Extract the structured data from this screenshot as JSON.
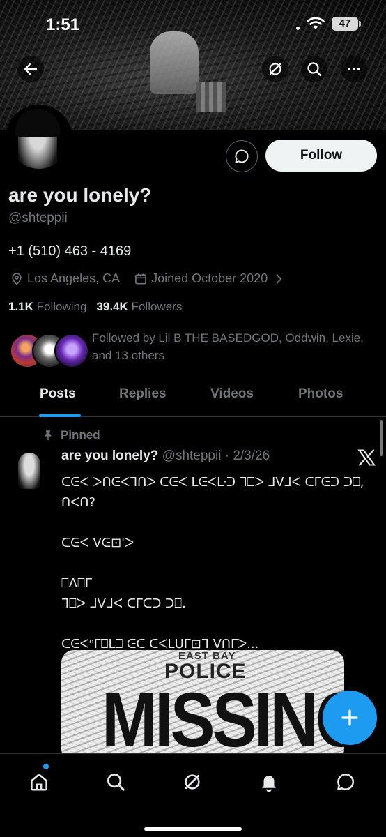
{
  "status_bar": {
    "time": "1:51",
    "battery": "47"
  },
  "profile": {
    "name": "are you lonely?",
    "handle": "@shteppii",
    "bio": "+1 (510) 463 - 4169",
    "location": "Los Angeles, CA",
    "joined": "Joined October 2020",
    "following_count": "1.1K",
    "following_label": "Following",
    "followers_count": "39.4K",
    "followers_label": "Followers",
    "followed_by": "Followed by Lil B THE BASEDGOD, Oddwin, Lexie, and 13 others"
  },
  "actions": {
    "follow_label": "Follow"
  },
  "tabs": [
    {
      "label": "Posts"
    },
    {
      "label": "Replies"
    },
    {
      "label": "Videos"
    },
    {
      "label": "Photos"
    }
  ],
  "pinned_post": {
    "pinned_label": "Pinned",
    "author_name": "are you lonely?",
    "author_meta": "@shteppii · 2/3/26",
    "text": "ᑕᕮᐸ ᐳᑎᕮᐸᒣᑎᐳ ᑕᕮᐸ ᒪᕮᐸᒷᑐ ᒣ⎕ᐳ ᒧᐯᒧᐸ ᑕᒥᕮᑐ ᑐ⎕,\nᑎᐸᑎ?\n\nᑕᕮᐸ ᐯᕮ⊡'ᐳ\n\n⎕ᐱ⎕ᒥ\nᒣ⎕ᐳ ᒧᐯᒧᐸ ᑕᒥᕮᑐ ᑐ⎕.\n\nᑕᕮᐸᐢᒥ⎕ᒪ⎕ ᕮᑕ ᑕᐸᒪᑌᒥ⊡ᒣ ᐯᑎᒥᐳ...",
    "image_text": {
      "top": "EAST BAY",
      "middle": "POLICE",
      "big": "MISSING"
    }
  },
  "icons": {
    "back": "back-arrow-icon",
    "grok": "grok-icon",
    "search": "search-icon",
    "more": "more-icon",
    "message": "message-icon",
    "location": "location-pin-icon",
    "calendar": "calendar-icon",
    "chevron": "chevron-right-icon",
    "pin": "pin-icon",
    "x_logo": "x-logo-icon",
    "compose": "plus-icon",
    "home": "home-icon",
    "explore": "search-icon",
    "grok_nav": "grok-icon",
    "notifications": "bell-icon",
    "messages": "message-icon"
  },
  "colors": {
    "accent": "#1d9bf0",
    "muted": "#71767b",
    "text": "#e7e9ea",
    "background": "#000000"
  }
}
